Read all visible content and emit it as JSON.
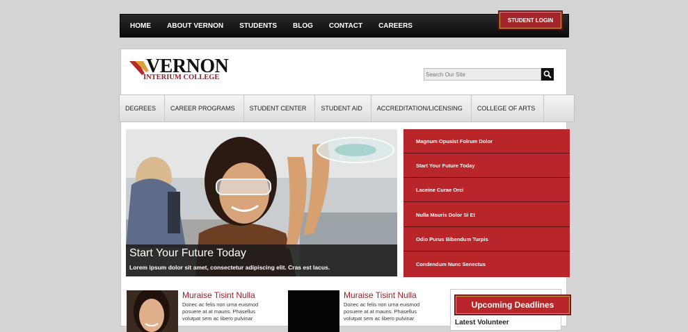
{
  "topnav": {
    "items": [
      "HOME",
      "ABOUT VERNON",
      "STUDENTS",
      "BLOG",
      "CONTACT",
      "CAREERS"
    ],
    "login_label": "STUDENT LOGIN"
  },
  "logo": {
    "name": "VERNON",
    "subtitle": "INTERIUM COLLEGE"
  },
  "search": {
    "placeholder": "Search Our Site",
    "icon": "search-icon"
  },
  "mainnav": {
    "items": [
      "DEGREES",
      "CAREER PROGRAMS",
      "STUDENT CENTER",
      "STUDENT AID",
      "ACCREDITATION/LICENSING",
      "COLLEGE OF ARTS"
    ]
  },
  "hero": {
    "title": "Start Your Future Today",
    "text": "Lorem ipsum dolor sit amet, consectetur adipiscing elit. Cras est lacus."
  },
  "sidemenu": {
    "items": [
      "Magnum Opusist Folrum Dolor",
      "Start Your Future Today",
      "Laceine Curae Orci",
      "Nulla Mauris Dolor Si Et",
      "Odio Purus Bibendum Turpis",
      "Condendum Nunc Senectus"
    ]
  },
  "articles": [
    {
      "title": "Muraise Tisint Nulla",
      "lines": [
        "Donec ac felis non urna euismod",
        "posuere at at mauris. Phasellus",
        "volutpat sem ac libero pulvinar"
      ]
    },
    {
      "title": "Muraise Tisint Nulla",
      "lines": [
        "Donec ac felis non urna euismod",
        "posuere at at mauris. Phasellus",
        "volutpat sem ac libero pulvinar"
      ]
    }
  ],
  "deadlines": {
    "title": "Upcoming Deadlines",
    "subtitle": "Latest Volunteer"
  },
  "colors": {
    "brand_red": "#b8262a",
    "dark_bar": "#111111",
    "accent_gold": "#c9a35a"
  }
}
